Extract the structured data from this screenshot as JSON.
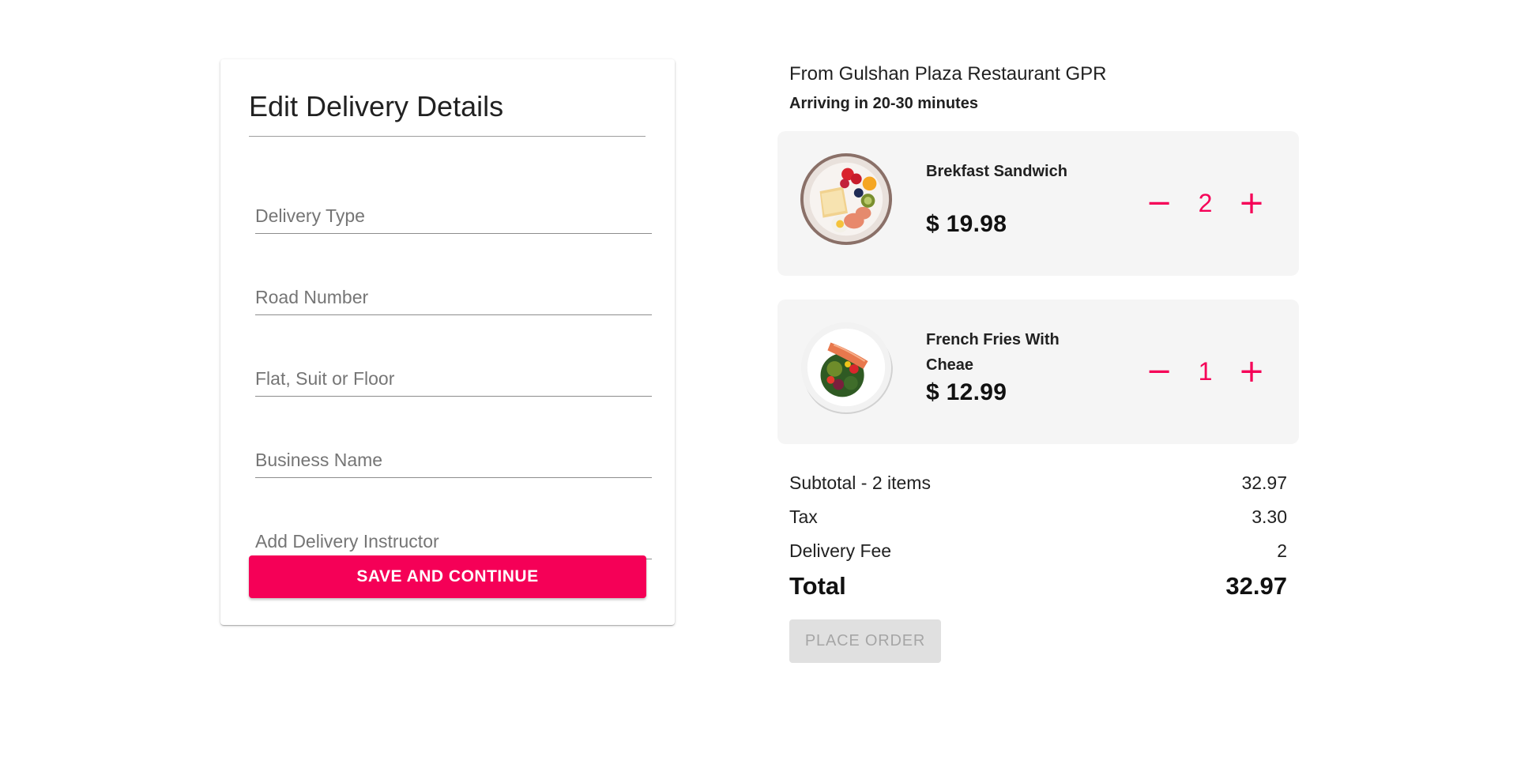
{
  "form": {
    "title": "Edit Delivery Details",
    "fields": [
      {
        "placeholder": "Delivery Type",
        "value": ""
      },
      {
        "placeholder": "Road Number",
        "value": ""
      },
      {
        "placeholder": "Flat, Suit or Floor",
        "value": ""
      },
      {
        "placeholder": "Business Name",
        "value": ""
      },
      {
        "placeholder": "Add Delivery Instructor",
        "value": ""
      }
    ],
    "save_label": "SAVE AND CONTINUE"
  },
  "order": {
    "restaurant": "From Gulshan Plaza Restaurant GPR",
    "eta": "Arriving in 20-30 minutes",
    "items": [
      {
        "name": "Brekfast Sandwich",
        "price": "$ 19.98",
        "quantity": "2",
        "image_icon": "breakfast-plate"
      },
      {
        "name": "French Fries With Cheae",
        "price": "$ 12.99",
        "quantity": "1",
        "image_icon": "salmon-salad-plate"
      }
    ],
    "minus_symbol": "−",
    "plus_symbol": "+"
  },
  "summary": {
    "subtotal_label": "Subtotal - 2 items",
    "subtotal_value": "32.97",
    "tax_label": "Tax",
    "tax_value": "3.30",
    "delivery_fee_label": "Delivery Fee",
    "delivery_fee_value": "2",
    "total_label": "Total",
    "total_value": "32.97"
  },
  "place_order_label": "PLACE ORDER",
  "colors": {
    "accent": "#f50057",
    "card_bg": "#f5f5f5",
    "disabled_bg": "#e0e0e0",
    "disabled_text": "#a6a6a6"
  }
}
